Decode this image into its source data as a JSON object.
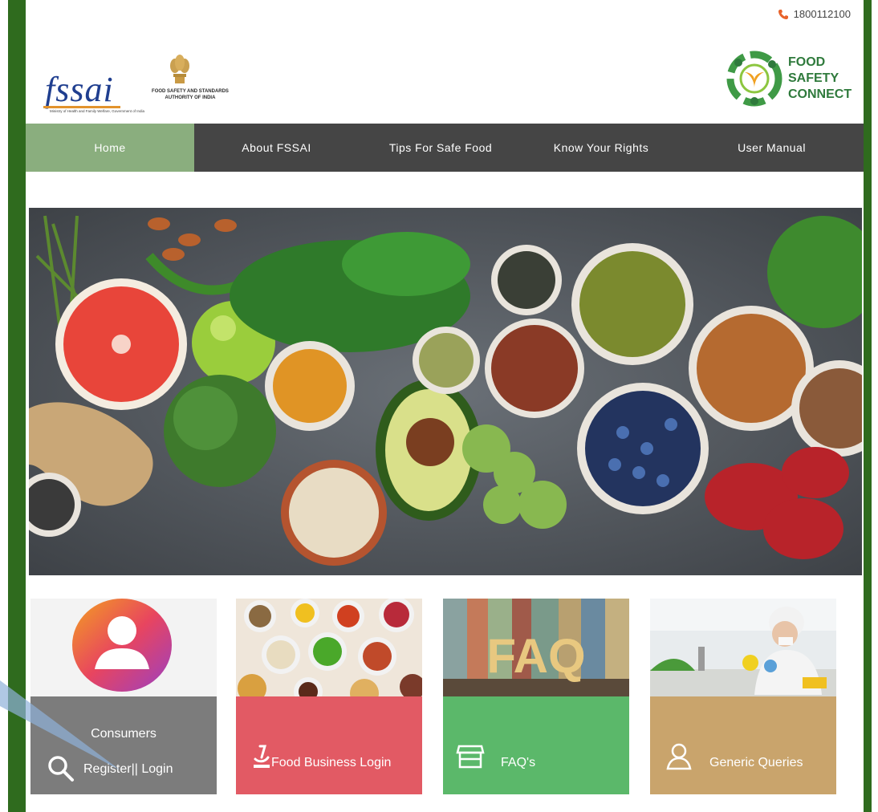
{
  "header": {
    "phone": "1800112100"
  },
  "fssai_logo": {
    "wordmark": "fssai",
    "full_name_line1": "FOOD SAFETY AND STANDARDS",
    "full_name_line2": "AUTHORITY OF INDIA",
    "ministry": "Ministry of Health and Family Welfare, Government of India"
  },
  "fsc_logo": {
    "line1": "FOOD",
    "line2": "SAFETY",
    "line3": "CONNECT"
  },
  "nav": {
    "items": [
      {
        "label": "Home"
      },
      {
        "label": "About FSSAI"
      },
      {
        "label": "Tips For Safe Food"
      },
      {
        "label": "Know Your Rights"
      },
      {
        "label": "User Manual"
      }
    ]
  },
  "cards": {
    "consumers": {
      "title": "Consumers",
      "action": "Register|| Login"
    },
    "food_business": {
      "label": "Food Business Login"
    },
    "faq": {
      "label": "FAQ's",
      "image_text": "FAQ"
    },
    "generic": {
      "label": "Generic Queries"
    }
  },
  "colors": {
    "frame_green": "#2f6b1e",
    "nav_bg": "#454545",
    "nav_active": "#8aae7e",
    "consumers_band": "#7c7c7c",
    "food_business_band": "#e25a64",
    "faq_band": "#5bb86a",
    "generic_band": "#c9a46c"
  }
}
